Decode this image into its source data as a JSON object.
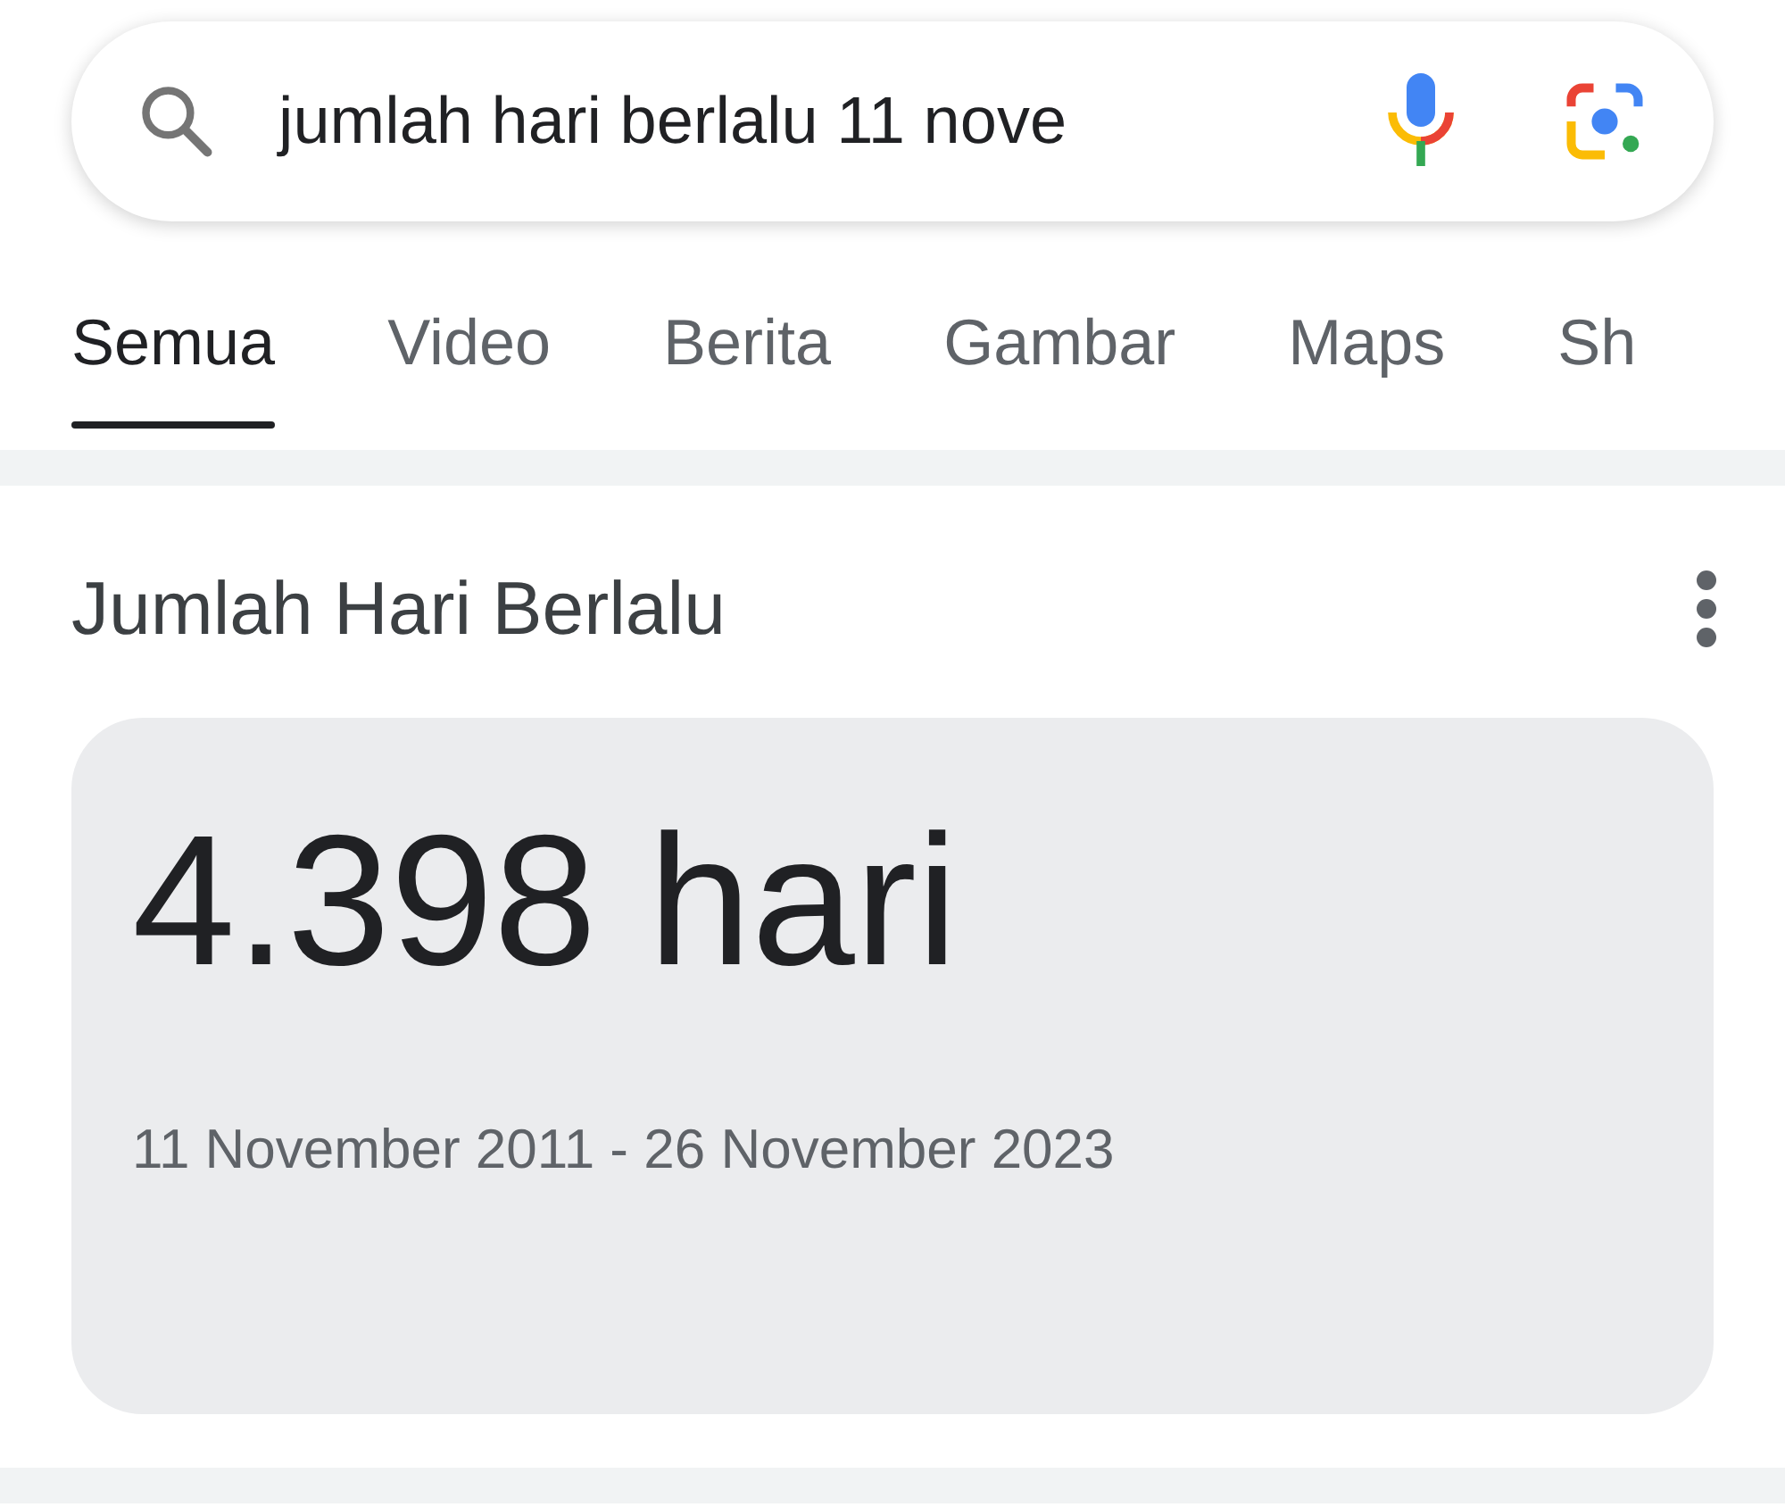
{
  "search": {
    "value": "jumlah hari berlalu 11 nove"
  },
  "tabs": [
    {
      "label": "Semua",
      "selected": true
    },
    {
      "label": "Video",
      "selected": false
    },
    {
      "label": "Berita",
      "selected": false
    },
    {
      "label": "Gambar",
      "selected": false
    },
    {
      "label": "Maps",
      "selected": false
    },
    {
      "label": "Sh",
      "selected": false
    }
  ],
  "card": {
    "title": "Jumlah Hari Berlalu",
    "result": "4.398 hari",
    "range": "11 November 2011 - 26 November 2023"
  }
}
